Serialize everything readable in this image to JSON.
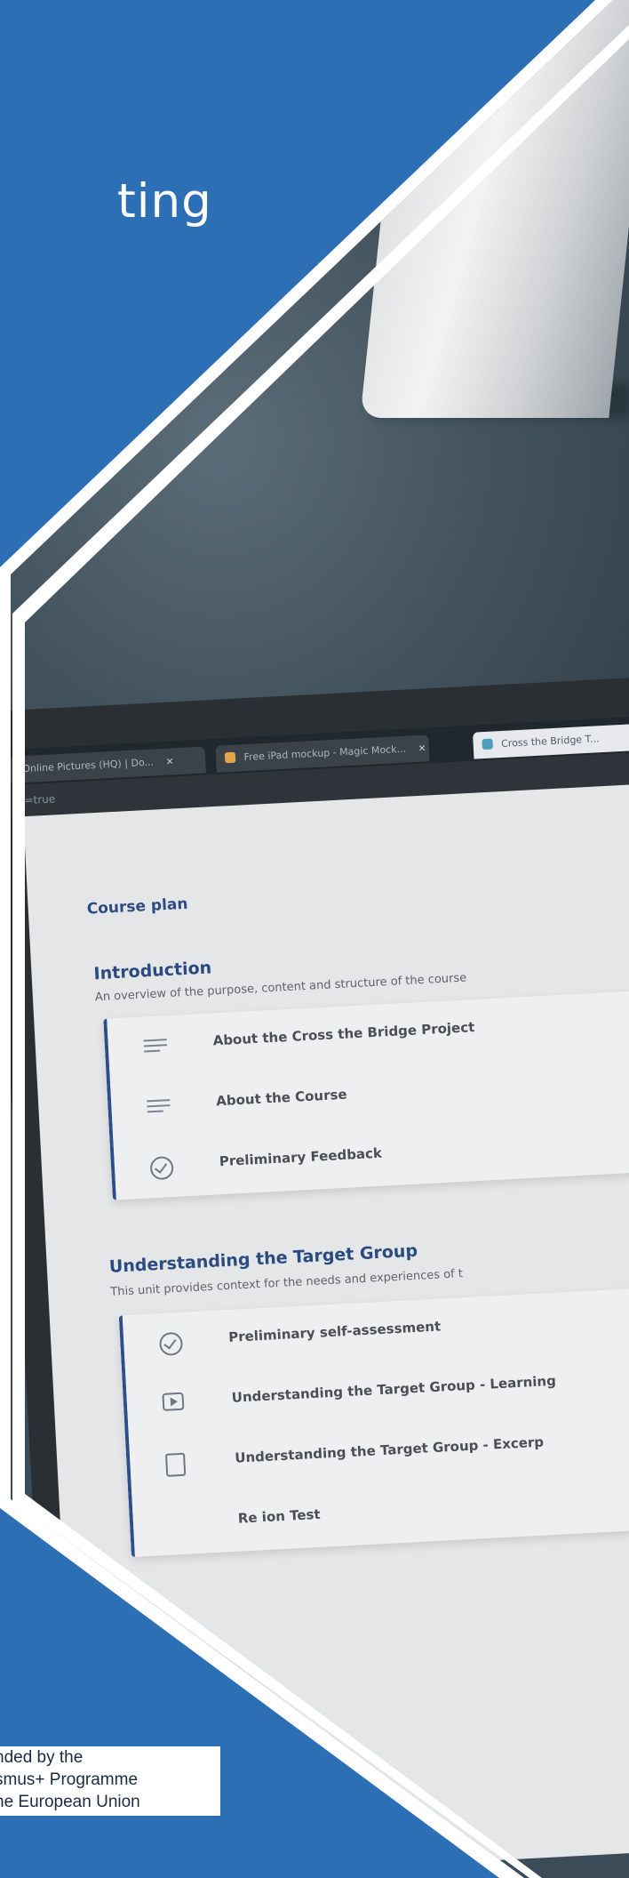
{
  "heading": "ting",
  "browser": {
    "tabs": [
      {
        "label": "<< Online Pictures (HQ) | Do...",
        "close": "×"
      },
      {
        "label": "Free iPad mockup - Magic Mock...",
        "close": "×"
      },
      {
        "label": "Cross the Bridge T..."
      }
    ],
    "address_fragment": "s=true"
  },
  "course": {
    "plan_title": "Course plan",
    "units": [
      {
        "title": "Introduction",
        "description": "An overview of the purpose, content and structure of the course",
        "items": [
          {
            "label": "About the Cross the Bridge Project",
            "icon": "text-lines-icon"
          },
          {
            "label": "About the Course",
            "icon": "text-lines-icon"
          },
          {
            "label": "Preliminary Feedback",
            "icon": "check-circle-icon"
          }
        ]
      },
      {
        "title": "Understanding the Target Group",
        "description": "This unit provides context for the needs and experiences of t",
        "items": [
          {
            "label": "Preliminary self-assessment",
            "icon": "check-circle-icon"
          },
          {
            "label": "Understanding the Target Group - Learning",
            "icon": "video-icon"
          },
          {
            "label": "Understanding the Target Group - Excerp",
            "icon": "document-icon"
          },
          {
            "label": "Re   ion Test",
            "icon": "check-circle-icon"
          }
        ]
      }
    ]
  },
  "funding": {
    "line1": "nded by the",
    "line2": "smus+ Programme",
    "line3": "he European Union"
  },
  "colors": {
    "brand_blue": "#2d6fb5",
    "course_title": "#2c4c83"
  }
}
